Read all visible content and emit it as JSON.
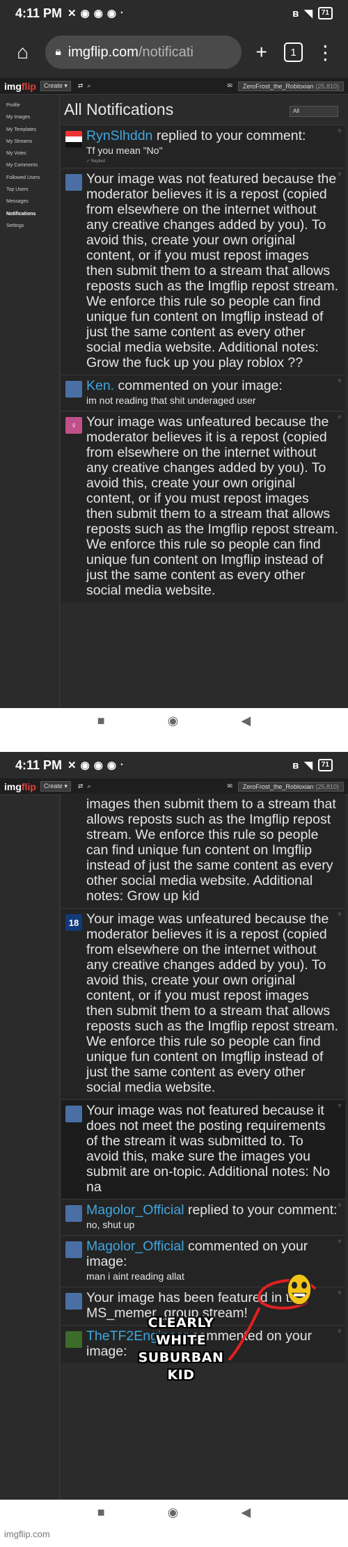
{
  "status": {
    "time": "4:11 PM",
    "battery": "71"
  },
  "browser": {
    "url_domain": "imgflip.com",
    "url_path": "/notificati",
    "tab_count": "1"
  },
  "site": {
    "logo_img": "img",
    "logo_flip": "flip",
    "create_label": "Create ▾",
    "username": "ZeroFrost_the_Robloxian",
    "user_points": "(25,810)"
  },
  "sidebar": [
    {
      "label": "Profile"
    },
    {
      "label": "My Images"
    },
    {
      "label": "My Templates"
    },
    {
      "label": "My Streams"
    },
    {
      "label": "My Votes"
    },
    {
      "label": "My Comments"
    },
    {
      "label": "Followed Users"
    },
    {
      "label": "Top Users"
    },
    {
      "label": "Messages"
    },
    {
      "label": "Notifications"
    },
    {
      "label": "Settings"
    }
  ],
  "page": {
    "title": "All Notifications",
    "filter": "All"
  },
  "shot1_notifications": [
    {
      "avatar": "flag",
      "user": "RynSlhddn",
      "text": " replied to your comment:",
      "sub": "Tf you mean \"No\"",
      "replied": "✓ Replied"
    },
    {
      "avatar": "cube",
      "user": "",
      "text": "Your image was not featured because the moderator believes it is a repost (copied from elsewhere on the internet without any creative changes added by you). To avoid this, create your own original content, or if you must repost images then submit them to a stream that allows reposts such as the Imgflip repost stream. We enforce this rule so people can find unique fun content on Imgflip instead of just the same content as every other social media website. Additional notes: Grow the fuck up you play roblox ??",
      "sub": "",
      "replied": ""
    },
    {
      "avatar": "cube",
      "user": "Ken.",
      "text": " commented on your image:",
      "sub": "im not reading that shit underaged user",
      "replied": ""
    },
    {
      "avatar": "fem",
      "user": "",
      "text": "Your image was unfeatured because the moderator believes it is a repost (copied from elsewhere on the internet without any creative changes added by you). To avoid this, create your own original content, or if you must repost images then submit them to a stream that allows reposts such as the Imgflip repost stream. We enforce this rule so people can find unique fun content on Imgflip instead of just the same content as every other social media website.",
      "sub": "",
      "replied": ""
    }
  ],
  "shot2_notifications": [
    {
      "avatar": "",
      "user": "",
      "text": "images then submit them to a stream that allows reposts such as the Imgflip repost stream. We enforce this rule so people can find unique fun content on Imgflip instead of just the same content as every other social media website. Additional notes: Grow up kid",
      "sub": "",
      "replied": ""
    },
    {
      "avatar": "18",
      "user": "",
      "text": "Your image was unfeatured because the moderator believes it is a repost (copied from elsewhere on the internet without any creative changes added by you). To avoid this, create your own original content, or if you must repost images then submit them to a stream that allows reposts such as the Imgflip repost stream. We enforce this rule so people can find unique fun content on Imgflip instead of just the same content as every other social media website.",
      "sub": "",
      "replied": ""
    },
    {
      "avatar": "cube",
      "user": "",
      "text": "Your image was not featured because it does not meet the posting requirements of the stream it was submitted to. To avoid this, make sure the images you submit are on-topic. Additional notes: No na",
      "sub": "",
      "replied": ""
    },
    {
      "avatar": "cube",
      "user": "Magolor_Official",
      "text": " replied to your comment:",
      "sub": "no, shut up",
      "replied": ""
    },
    {
      "avatar": "cube",
      "user": "Magolor_Official",
      "text": " commented on your image:",
      "sub": "man i aint reading allat",
      "replied": ""
    },
    {
      "avatar": "cube",
      "user": "",
      "text": "Your image has been featured in the MS_memer_group stream!",
      "sub": "",
      "replied": ""
    },
    {
      "avatar": "green",
      "user": "TheTF2Engineer",
      "text": " commented on your image:",
      "sub": "",
      "replied": ""
    }
  ],
  "overlay": {
    "line1": "CLEARLY",
    "line2": "WHITE",
    "line3": "SUBURBAN KID"
  },
  "watermark": "imgflip.com",
  "colors": {
    "link": "#3fa7e0",
    "bg": "#2b2b2b",
    "annotation": "#e02020"
  },
  "icons": [
    "home-icon",
    "lock-icon",
    "plus-icon",
    "tabs-icon",
    "menu-icon",
    "search-icon",
    "mail-icon",
    "shuffle-icon",
    "recent-apps-icon",
    "home-circle-icon",
    "back-icon",
    "bluetooth-icon",
    "wifi-icon"
  ]
}
